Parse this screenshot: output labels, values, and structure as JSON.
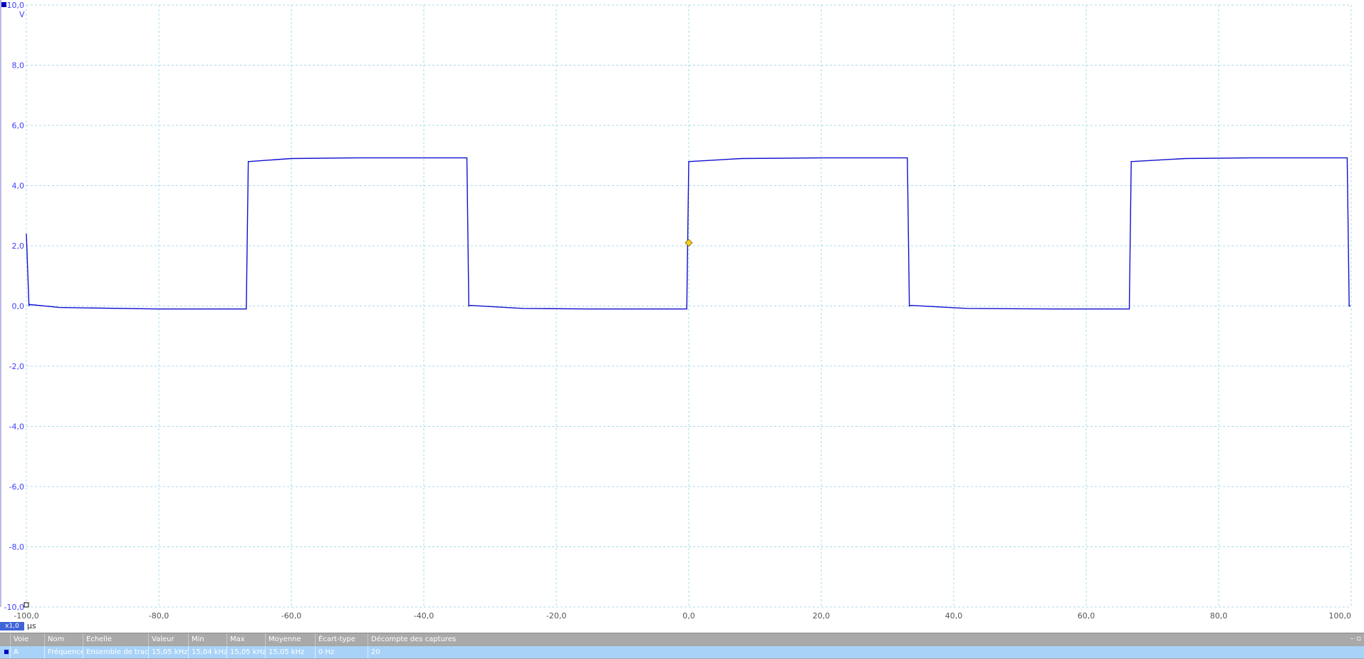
{
  "scope": {
    "y_unit": "V",
    "x_unit": "µs",
    "zoom_label": "x1,0",
    "trace_color": "#1010d0",
    "grid_color": "#a8d8e8",
    "trigger_color": "#f0d020"
  },
  "chart_data": {
    "type": "line",
    "xlabel": "µs",
    "ylabel": "V",
    "xlim": [
      -100,
      100
    ],
    "ylim": [
      -10,
      10
    ],
    "grid": true,
    "x_ticks": [
      "-100,0",
      "-80,0",
      "-60,0",
      "-40,0",
      "-20,0",
      "0,0",
      "20,0",
      "40,0",
      "60,0",
      "80,0",
      "100,0"
    ],
    "y_ticks": [
      "10,0",
      "8,0",
      "6,0",
      "4,0",
      "2,0",
      "0,0",
      "-2,0",
      "-4,0",
      "-6,0",
      "-8,0",
      "-10,0"
    ],
    "series": [
      {
        "x": [
          -100,
          -99.6,
          -99.5,
          -95,
          -80,
          -66.8,
          -66.5,
          -66.3,
          -60,
          -50,
          -33.5,
          -33.2,
          -33.0,
          -25,
          -15,
          -0.3,
          0.0,
          0.2,
          8,
          20,
          33.0,
          33.3,
          33.6,
          42,
          55,
          66.5,
          66.8,
          67.0,
          75,
          85,
          99.4,
          99.7,
          99.9
        ],
        "y": [
          2.4,
          0.0,
          0.05,
          -0.05,
          -0.1,
          -0.1,
          4.8,
          4.8,
          4.9,
          4.92,
          4.92,
          0.0,
          0.02,
          -0.08,
          -0.1,
          -0.1,
          4.8,
          4.8,
          4.9,
          4.92,
          4.92,
          0.0,
          0.02,
          -0.08,
          -0.1,
          -0.1,
          4.8,
          4.8,
          4.9,
          4.92,
          4.92,
          0.0,
          0.0
        ]
      }
    ],
    "trigger": {
      "x": 0.0,
      "y": 2.1
    }
  },
  "measurements": {
    "headers": [
      "Voie",
      "Nom",
      "Echelle",
      "Valeur",
      "Min",
      "Max",
      "Moyenne",
      "Écart-type",
      "Décompte des captures"
    ],
    "row": [
      "A",
      "Fréquence",
      "Ensemble de traces",
      "15,05 kHz",
      "15,04 kHz",
      "15,05 kHz",
      "15,05 kHz",
      "0 Hz",
      "20"
    ],
    "controls": "– ▫"
  }
}
